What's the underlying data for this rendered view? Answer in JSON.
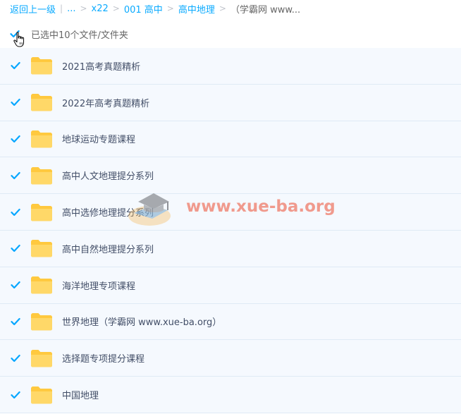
{
  "breadcrumb": {
    "back": "返回上一级",
    "ellipsis": "...",
    "items": [
      "x22",
      "001 高中",
      "高中地理"
    ],
    "current": "（学霸网 www..."
  },
  "selection": {
    "label": "已选中10个文件/文件夹",
    "checked": true
  },
  "files": [
    {
      "name": "2021高考真题精析",
      "checked": true
    },
    {
      "name": "2022年高考真题精析",
      "checked": true
    },
    {
      "name": "地球运动专题课程",
      "checked": true
    },
    {
      "name": "高中人文地理提分系列",
      "checked": true
    },
    {
      "name": "高中选修地理提分系列",
      "checked": true
    },
    {
      "name": "高中自然地理提分系列",
      "checked": true
    },
    {
      "name": "海洋地理专项课程",
      "checked": true
    },
    {
      "name": "世界地理（学霸网 www.xue-ba.org）",
      "checked": true
    },
    {
      "name": "选择题专项提分课程",
      "checked": true
    },
    {
      "name": "中国地理",
      "checked": true
    }
  ],
  "watermark": {
    "text": "www.xue-ba.org"
  },
  "icons": {
    "folder": "folder-icon",
    "checkbox": "checkbox-checked-icon",
    "cursor": "hand-cursor-icon",
    "watermark_logo": "graduation-cap-icon"
  },
  "colors": {
    "link": "#09aaff",
    "check": "#06a7ff",
    "row_bg": "#f5f9fe",
    "folder": "#ffd25a",
    "watermark": "#f08a7a"
  }
}
